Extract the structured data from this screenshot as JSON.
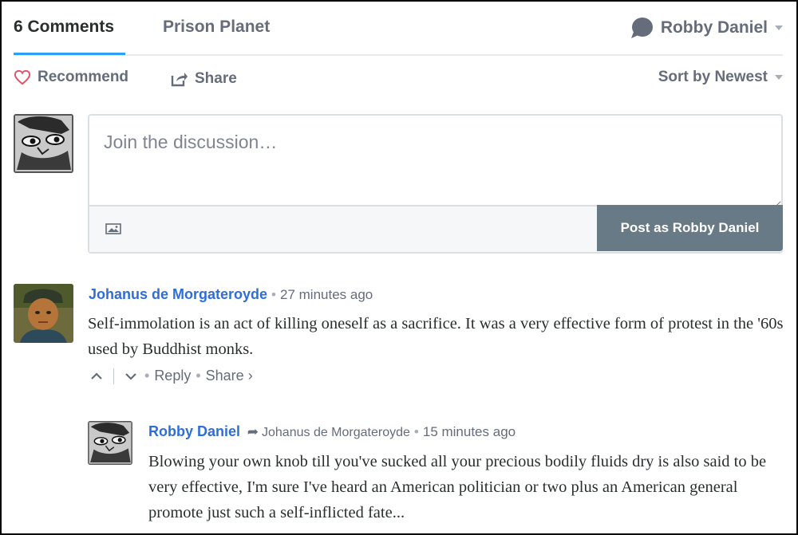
{
  "nav": {
    "comments_tab": "6 Comments",
    "site_tab": "Prison Planet",
    "user_name": "Robby Daniel"
  },
  "actions": {
    "recommend": "Recommend",
    "share": "Share",
    "sort": "Sort by Newest"
  },
  "composer": {
    "placeholder": "Join the discussion…",
    "post_button": "Post as Robby Daniel"
  },
  "comments": [
    {
      "author": "Johanus de Morgateroyde",
      "time": "27 minutes ago",
      "body": "Self-immolation is an act of killing oneself as a sacrifice. It was a very effective form of protest in the '60s used by Buddhist monks.",
      "reply_label": "Reply",
      "share_label": "Share ›",
      "separator": "•"
    },
    {
      "author": "Robby Daniel",
      "reply_to": "Johanus de Morgateroyde",
      "time": "15 minutes ago",
      "body": "Blowing your own knob till you've sucked all your precious bodily fluids dry is also said to be very effective, I'm sure I've heard an American politician or two plus an American general promote just such a self-inflicted fate...",
      "separator": "•"
    }
  ],
  "colors": {
    "accent_blue": "#2e9fff",
    "link_blue": "#2e6ed8",
    "muted": "#656c7a",
    "post_button_bg": "#687a86",
    "recommend_heart": "#e2546b"
  },
  "icons": {
    "recommend": "heart-outline-icon",
    "share": "share-arrow-icon",
    "user_menu": "speech-bubble-icon",
    "image_upload": "image-icon",
    "upvote": "chevron-up-icon",
    "downvote": "chevron-down-icon",
    "reply_arrow": "reply-arrow-icon"
  }
}
